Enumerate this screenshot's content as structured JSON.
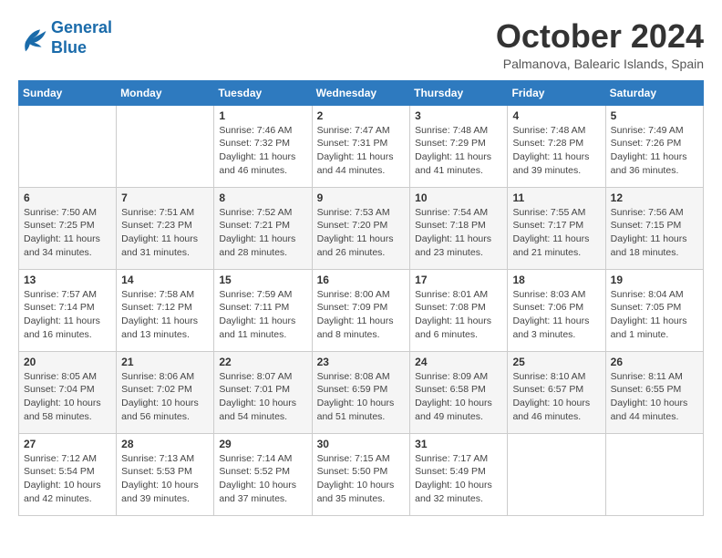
{
  "header": {
    "logo_line1": "General",
    "logo_line2": "Blue",
    "month": "October 2024",
    "location": "Palmanova, Balearic Islands, Spain"
  },
  "days_of_week": [
    "Sunday",
    "Monday",
    "Tuesday",
    "Wednesday",
    "Thursday",
    "Friday",
    "Saturday"
  ],
  "weeks": [
    [
      {
        "day": "",
        "info": ""
      },
      {
        "day": "",
        "info": ""
      },
      {
        "day": "1",
        "info": "Sunrise: 7:46 AM\nSunset: 7:32 PM\nDaylight: 11 hours and 46 minutes."
      },
      {
        "day": "2",
        "info": "Sunrise: 7:47 AM\nSunset: 7:31 PM\nDaylight: 11 hours and 44 minutes."
      },
      {
        "day": "3",
        "info": "Sunrise: 7:48 AM\nSunset: 7:29 PM\nDaylight: 11 hours and 41 minutes."
      },
      {
        "day": "4",
        "info": "Sunrise: 7:48 AM\nSunset: 7:28 PM\nDaylight: 11 hours and 39 minutes."
      },
      {
        "day": "5",
        "info": "Sunrise: 7:49 AM\nSunset: 7:26 PM\nDaylight: 11 hours and 36 minutes."
      }
    ],
    [
      {
        "day": "6",
        "info": "Sunrise: 7:50 AM\nSunset: 7:25 PM\nDaylight: 11 hours and 34 minutes."
      },
      {
        "day": "7",
        "info": "Sunrise: 7:51 AM\nSunset: 7:23 PM\nDaylight: 11 hours and 31 minutes."
      },
      {
        "day": "8",
        "info": "Sunrise: 7:52 AM\nSunset: 7:21 PM\nDaylight: 11 hours and 28 minutes."
      },
      {
        "day": "9",
        "info": "Sunrise: 7:53 AM\nSunset: 7:20 PM\nDaylight: 11 hours and 26 minutes."
      },
      {
        "day": "10",
        "info": "Sunrise: 7:54 AM\nSunset: 7:18 PM\nDaylight: 11 hours and 23 minutes."
      },
      {
        "day": "11",
        "info": "Sunrise: 7:55 AM\nSunset: 7:17 PM\nDaylight: 11 hours and 21 minutes."
      },
      {
        "day": "12",
        "info": "Sunrise: 7:56 AM\nSunset: 7:15 PM\nDaylight: 11 hours and 18 minutes."
      }
    ],
    [
      {
        "day": "13",
        "info": "Sunrise: 7:57 AM\nSunset: 7:14 PM\nDaylight: 11 hours and 16 minutes."
      },
      {
        "day": "14",
        "info": "Sunrise: 7:58 AM\nSunset: 7:12 PM\nDaylight: 11 hours and 13 minutes."
      },
      {
        "day": "15",
        "info": "Sunrise: 7:59 AM\nSunset: 7:11 PM\nDaylight: 11 hours and 11 minutes."
      },
      {
        "day": "16",
        "info": "Sunrise: 8:00 AM\nSunset: 7:09 PM\nDaylight: 11 hours and 8 minutes."
      },
      {
        "day": "17",
        "info": "Sunrise: 8:01 AM\nSunset: 7:08 PM\nDaylight: 11 hours and 6 minutes."
      },
      {
        "day": "18",
        "info": "Sunrise: 8:03 AM\nSunset: 7:06 PM\nDaylight: 11 hours and 3 minutes."
      },
      {
        "day": "19",
        "info": "Sunrise: 8:04 AM\nSunset: 7:05 PM\nDaylight: 11 hours and 1 minute."
      }
    ],
    [
      {
        "day": "20",
        "info": "Sunrise: 8:05 AM\nSunset: 7:04 PM\nDaylight: 10 hours and 58 minutes."
      },
      {
        "day": "21",
        "info": "Sunrise: 8:06 AM\nSunset: 7:02 PM\nDaylight: 10 hours and 56 minutes."
      },
      {
        "day": "22",
        "info": "Sunrise: 8:07 AM\nSunset: 7:01 PM\nDaylight: 10 hours and 54 minutes."
      },
      {
        "day": "23",
        "info": "Sunrise: 8:08 AM\nSunset: 6:59 PM\nDaylight: 10 hours and 51 minutes."
      },
      {
        "day": "24",
        "info": "Sunrise: 8:09 AM\nSunset: 6:58 PM\nDaylight: 10 hours and 49 minutes."
      },
      {
        "day": "25",
        "info": "Sunrise: 8:10 AM\nSunset: 6:57 PM\nDaylight: 10 hours and 46 minutes."
      },
      {
        "day": "26",
        "info": "Sunrise: 8:11 AM\nSunset: 6:55 PM\nDaylight: 10 hours and 44 minutes."
      }
    ],
    [
      {
        "day": "27",
        "info": "Sunrise: 7:12 AM\nSunset: 5:54 PM\nDaylight: 10 hours and 42 minutes."
      },
      {
        "day": "28",
        "info": "Sunrise: 7:13 AM\nSunset: 5:53 PM\nDaylight: 10 hours and 39 minutes."
      },
      {
        "day": "29",
        "info": "Sunrise: 7:14 AM\nSunset: 5:52 PM\nDaylight: 10 hours and 37 minutes."
      },
      {
        "day": "30",
        "info": "Sunrise: 7:15 AM\nSunset: 5:50 PM\nDaylight: 10 hours and 35 minutes."
      },
      {
        "day": "31",
        "info": "Sunrise: 7:17 AM\nSunset: 5:49 PM\nDaylight: 10 hours and 32 minutes."
      },
      {
        "day": "",
        "info": ""
      },
      {
        "day": "",
        "info": ""
      }
    ]
  ]
}
